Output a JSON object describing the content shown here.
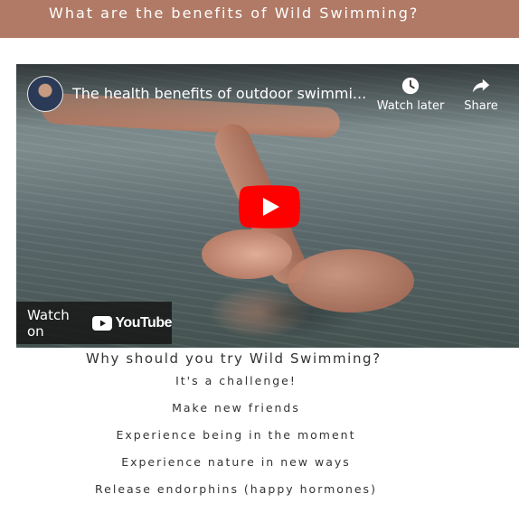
{
  "banner": {
    "title": "What are the benefits of Wild Swimming?"
  },
  "video": {
    "title": "The health benefits of outdoor swimmi...",
    "watch_later_label": "Watch later",
    "share_label": "Share",
    "watch_on_label": "Watch on",
    "youtube_label": "YouTube",
    "icons": {
      "avatar": "channel-avatar",
      "watch_later": "clock-icon",
      "share": "share-arrow-icon",
      "play": "play-button-icon"
    },
    "colors": {
      "play_red": "#ff0000",
      "banner": "#b07a66"
    }
  },
  "section": {
    "title": "Why should you try Wild Swimming?",
    "reasons": [
      "It's a challenge!",
      "Make new friends",
      "Experience being in the moment",
      "Experience nature in new ways",
      "Release endorphins (happy hormones)"
    ]
  }
}
